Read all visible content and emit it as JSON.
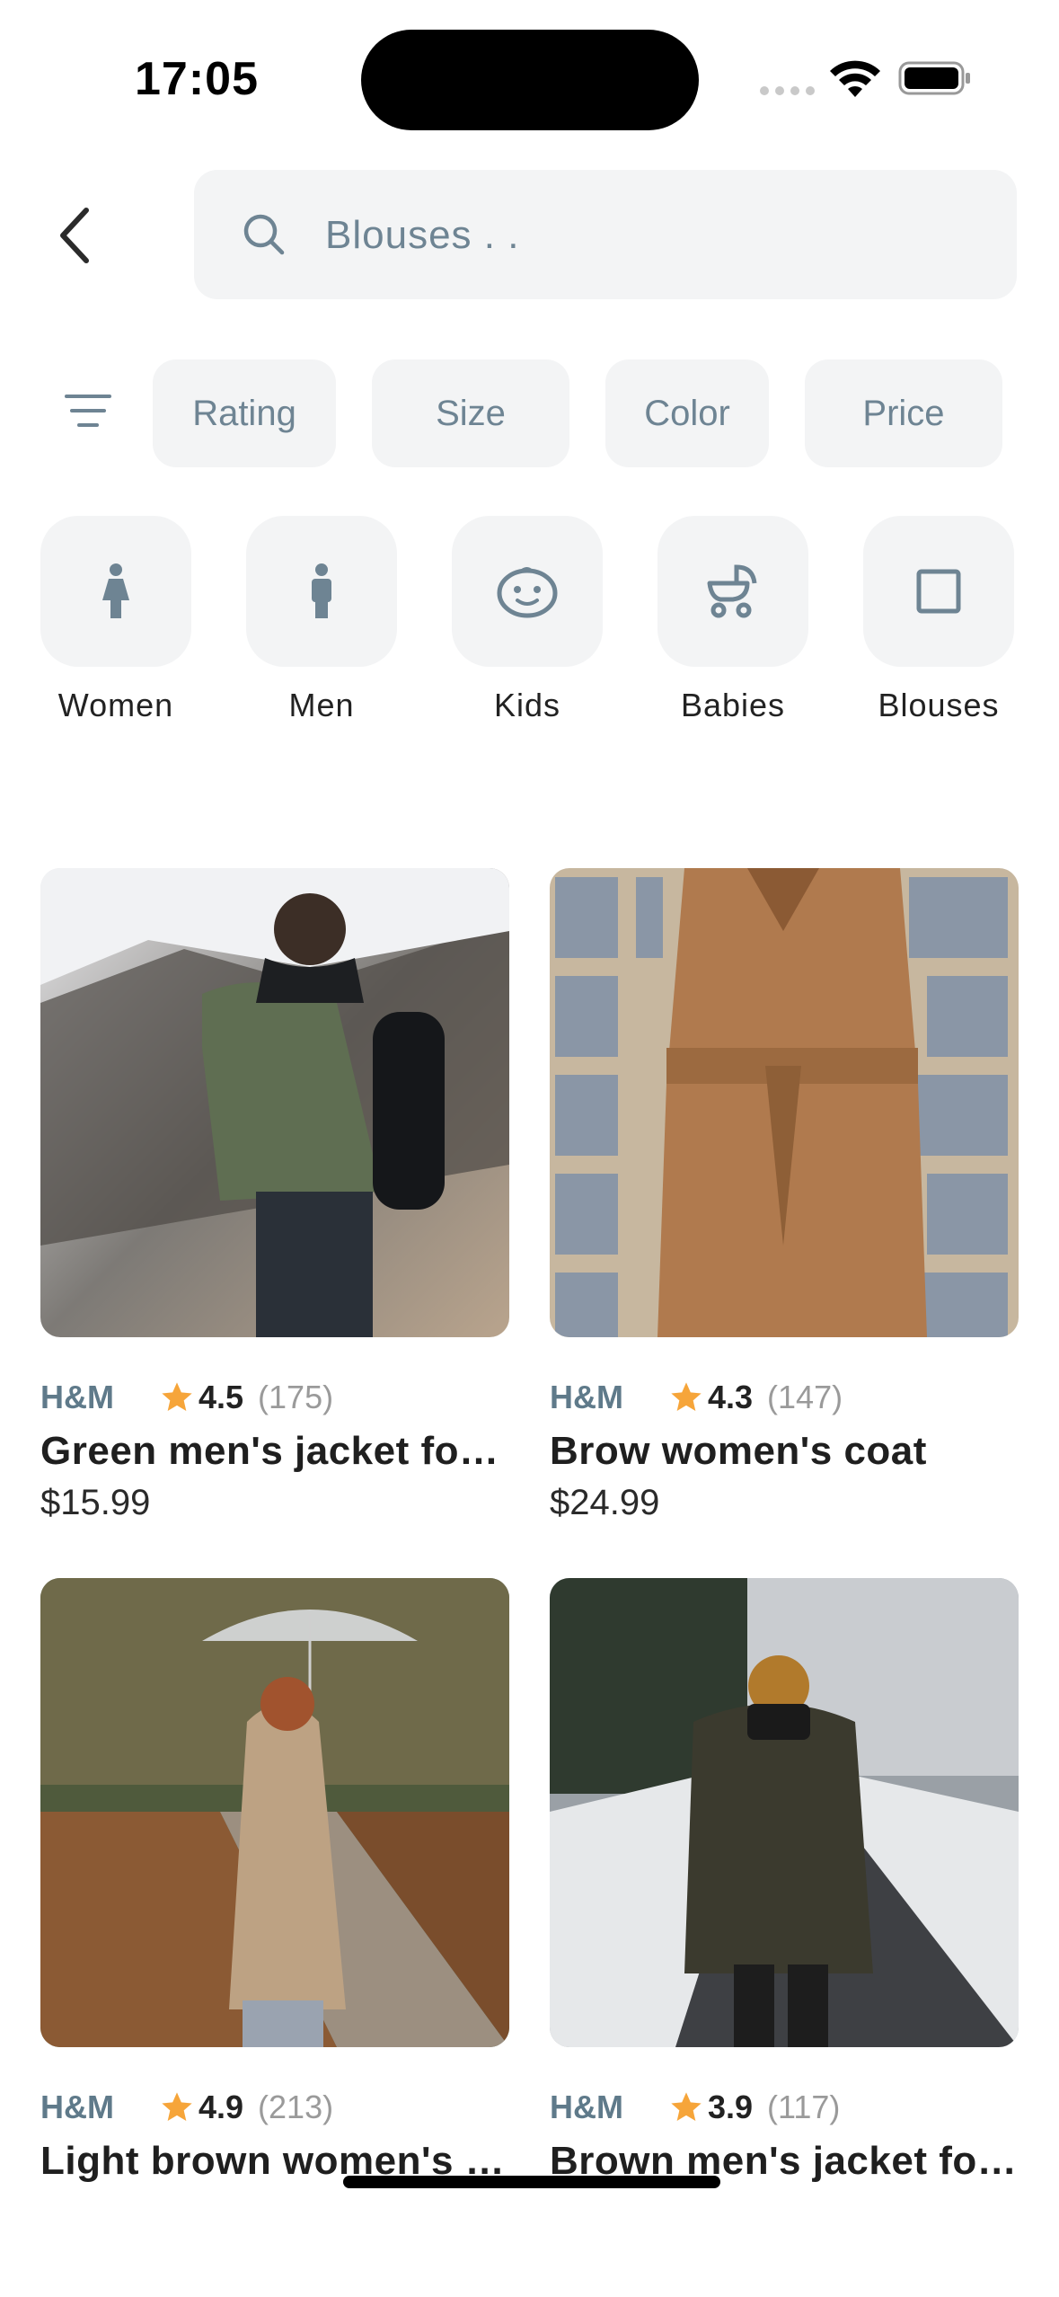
{
  "status_bar": {
    "time": "17:05"
  },
  "search": {
    "placeholder": "Blouses . ."
  },
  "filters": [
    "Rating",
    "Size",
    "Color",
    "Price"
  ],
  "categories": [
    {
      "label": "Women",
      "icon": "woman-icon"
    },
    {
      "label": "Men",
      "icon": "man-icon"
    },
    {
      "label": "Kids",
      "icon": "child-face-icon"
    },
    {
      "label": "Babies",
      "icon": "stroller-icon"
    },
    {
      "label": "Blouses",
      "icon": "square-icon"
    }
  ],
  "products": [
    {
      "brand": "H&M",
      "rating": "4.5",
      "count": "(175)",
      "name": "Green men's jacket for winter",
      "price": "$15.99"
    },
    {
      "brand": "H&M",
      "rating": "4.3",
      "count": "(147)",
      "name": "Brow women's coat",
      "price": "$24.99"
    },
    {
      "brand": "H&M",
      "rating": "4.9",
      "count": "(213)",
      "name": "Light brown women's trench coat",
      "price": ""
    },
    {
      "brand": "H&M",
      "rating": "3.9",
      "count": "(117)",
      "name": "Brown men's jacket for winter",
      "price": ""
    }
  ],
  "colors": {
    "accent_text": "#6e8493",
    "star": "#f6a53a",
    "chip_bg": "#f3f4f5"
  }
}
